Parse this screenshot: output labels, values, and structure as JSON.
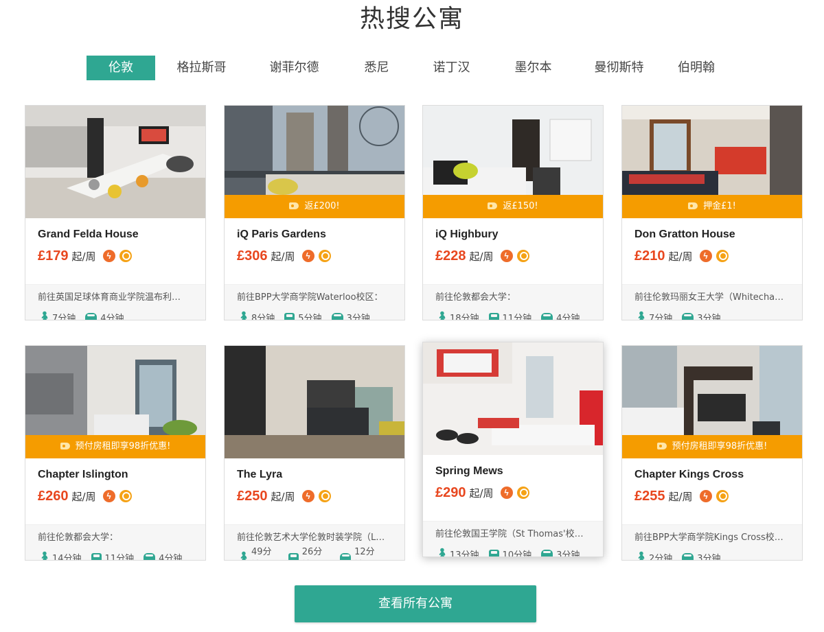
{
  "title": "热搜公寓",
  "tabs": [
    {
      "label": "伦敦",
      "active": true
    },
    {
      "label": "格拉斯哥"
    },
    {
      "label": "谢菲尔德"
    },
    {
      "label": "悉尼"
    },
    {
      "label": "诺丁汉"
    },
    {
      "label": "墨尔本"
    },
    {
      "label": "曼彻斯特"
    },
    {
      "label": "伯明翰"
    }
  ],
  "colors": {
    "accent": "#2fa792",
    "price": "#e8471f",
    "promo": "#f59c00"
  },
  "unit_label": "起/周",
  "cards": [
    {
      "name": "Grand Felda House",
      "price": "£179",
      "promo": "",
      "dest": "前往英国足球体育商业学院温布利…",
      "walk": "7分钟",
      "bus": "",
      "car": "4分钟"
    },
    {
      "name": "iQ Paris Gardens",
      "price": "£306",
      "promo": "返£200!",
      "dest": "前往BPP大学商学院Waterloo校区：",
      "walk": "8分钟",
      "bus": "5分钟",
      "car": "3分钟"
    },
    {
      "name": "iQ Highbury",
      "price": "£228",
      "promo": "返£150!",
      "dest": "前往伦敦都会大学：",
      "walk": "18分钟",
      "bus": "11分钟",
      "car": "4分钟"
    },
    {
      "name": "Don Gratton House",
      "price": "£210",
      "promo": "押金£1!",
      "dest": "前往伦敦玛丽女王大学（Whitecha…",
      "walk": "7分钟",
      "bus": "",
      "car": "3分钟"
    },
    {
      "name": "Chapter Islington",
      "price": "£260",
      "promo": "预付房租即享98折优惠!",
      "dest": "前往伦敦都会大学：",
      "walk": "14分钟",
      "bus": "11分钟",
      "car": "4分钟"
    },
    {
      "name": "The Lyra",
      "price": "£250",
      "promo": "",
      "dest": "前往伦敦艺术大学伦敦时装学院（L…",
      "walk": "49分钟",
      "bus": "26分钟",
      "car": "12分钟"
    },
    {
      "name": "Spring Mews",
      "price": "£290",
      "promo": "",
      "dest": "前往伦敦国王学院（St Thomas'校…",
      "walk": "13分钟",
      "bus": "10分钟",
      "car": "3分钟"
    },
    {
      "name": "Chapter Kings Cross",
      "price": "£255",
      "promo": "预付房租即享98折优惠!",
      "dest": "前往BPP大学商学院Kings Cross校…",
      "walk": "2分钟",
      "bus": "",
      "car": "3分钟"
    }
  ],
  "view_all_label": "查看所有公寓"
}
